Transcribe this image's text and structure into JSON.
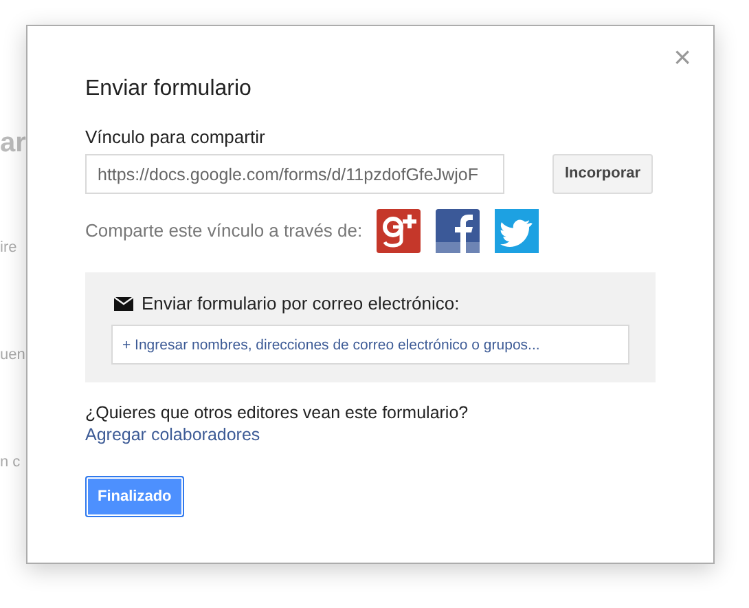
{
  "background_fragments": [
    {
      "text": "ar",
      "kind": "heading"
    },
    {
      "text": "ire",
      "kind": "label"
    },
    {
      "text": "uen",
      "kind": "label"
    },
    {
      "text": "n c",
      "kind": "label"
    }
  ],
  "dialog": {
    "title": "Enviar formulario",
    "close": "×",
    "link_label": "Vínculo para compartir",
    "link_value": "https://docs.google.com/forms/d/11pzdofGfeJwjoF",
    "embed_button": "Incorporar",
    "share_label": "Comparte este vínculo a través de:",
    "share_services": [
      {
        "kind": "gplus"
      },
      {
        "kind": "facebook"
      },
      {
        "kind": "twitter"
      }
    ],
    "email_label": "Enviar formulario por correo electrónico:",
    "email_placeholder": "+ Ingresar nombres, direcciones de correo electrónico o grupos...",
    "collab_question": "¿Quieres que otros editores vean este formulario?",
    "collab_link": "Agregar colaboradores",
    "done_button": "Finalizado"
  }
}
